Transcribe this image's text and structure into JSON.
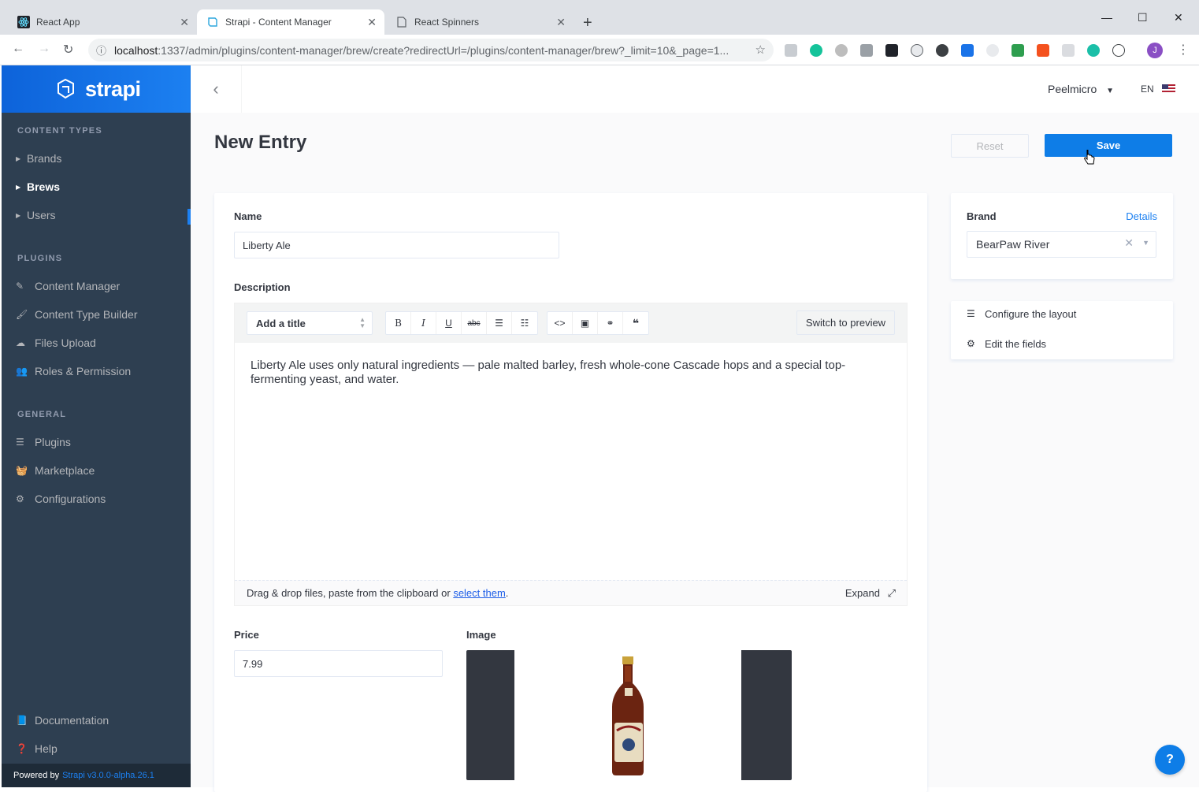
{
  "browser": {
    "tabs": [
      {
        "title": "React App",
        "favicon": "react-icon"
      },
      {
        "title": "Strapi - Content Manager",
        "favicon": "strapi-icon"
      },
      {
        "title": "React Spinners",
        "favicon": "page-icon"
      }
    ],
    "url_host": "localhost",
    "url_path": ":1337/admin/plugins/content-manager/brew/create?redirectUrl=/plugins/content-manager/brew?_limit=10&_page=1...",
    "profile_initial": "J"
  },
  "sidebar": {
    "brand": "strapi",
    "sections": {
      "content_types": "CONTENT TYPES",
      "plugins": "PLUGINS",
      "general": "GENERAL"
    },
    "content_types": [
      {
        "label": "Brands"
      },
      {
        "label": "Brews"
      },
      {
        "label": "Users"
      }
    ],
    "plugins": [
      {
        "label": "Content Manager",
        "icon": "paint-brush-icon"
      },
      {
        "label": "Content Type Builder",
        "icon": "brush-icon"
      },
      {
        "label": "Files Upload",
        "icon": "cloud-upload-icon"
      },
      {
        "label": "Roles & Permission",
        "icon": "users-icon"
      }
    ],
    "general": [
      {
        "label": "Plugins",
        "icon": "list-icon"
      },
      {
        "label": "Marketplace",
        "icon": "basket-icon"
      },
      {
        "label": "Configurations",
        "icon": "gear-icon"
      }
    ],
    "footer_links": [
      {
        "label": "Documentation",
        "icon": "book-icon"
      },
      {
        "label": "Help",
        "icon": "question-icon"
      }
    ],
    "powered_by": "Powered by",
    "version": "Strapi v3.0.0-alpha.26.1"
  },
  "topbar": {
    "user": "Peelmicro",
    "lang": "EN"
  },
  "page": {
    "title": "New Entry",
    "reset_label": "Reset",
    "save_label": "Save"
  },
  "form": {
    "name_label": "Name",
    "name_value": "Liberty Ale",
    "description_label": "Description",
    "heading_select": "Add a title",
    "switch_preview": "Switch to preview",
    "description_value": "Liberty Ale uses only natural ingredients — pale malted barley, fresh whole-cone Cascade hops and a special top-fermenting yeast, and water.",
    "drop_text": "Drag & drop files, paste from the clipboard or",
    "drop_link": "select them",
    "drop_period": ".",
    "expand_label": "Expand",
    "price_label": "Price",
    "price_value": "7.99",
    "image_label": "Image"
  },
  "relations": {
    "brand_label": "Brand",
    "details_link": "Details",
    "brand_value": "BearPaw River"
  },
  "layout_links": {
    "configure": "Configure the layout",
    "edit_fields": "Edit the fields"
  },
  "help_fab": "?"
}
